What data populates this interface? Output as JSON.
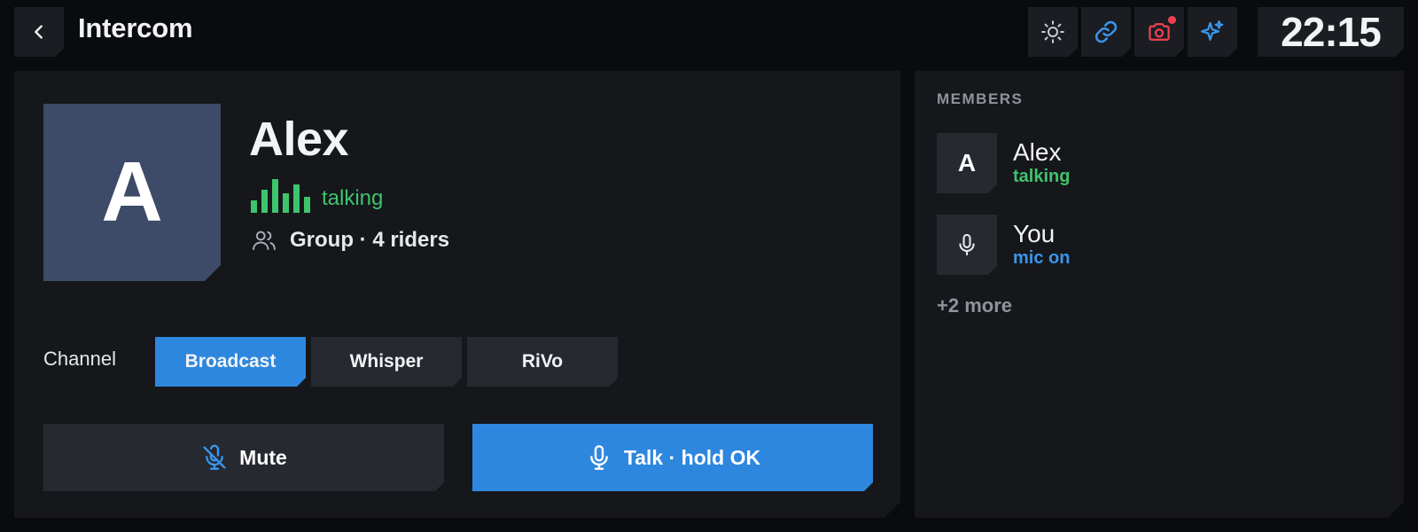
{
  "header": {
    "title": "Intercom",
    "clock": "22:15",
    "tools": [
      {
        "icon": "sun-icon"
      },
      {
        "icon": "link-icon"
      },
      {
        "icon": "camera-icon",
        "notification": true
      },
      {
        "icon": "sparkle-icon"
      }
    ]
  },
  "contact": {
    "initial": "A",
    "name": "Alex",
    "status": "talking",
    "group": "Group · 4 riders"
  },
  "channel": {
    "label": "Channel",
    "options": [
      "Broadcast",
      "Whisper",
      "RiVo"
    ],
    "selected": "Broadcast"
  },
  "actions": {
    "mute_label": "Mute",
    "talk_label": "Talk · hold OK"
  },
  "members": {
    "title": "MEMBERS",
    "list": [
      {
        "initial": "A",
        "name": "Alex",
        "status": "talking",
        "status_color": "#3ec46d"
      },
      {
        "icon": "microphone-icon",
        "name": "You",
        "status": "mic on",
        "status_color": "#2e87de"
      }
    ],
    "more": "+2 more"
  },
  "colors": {
    "accent": "#2e87de",
    "talking": "#3ec46d",
    "notification": "#f0404f"
  }
}
